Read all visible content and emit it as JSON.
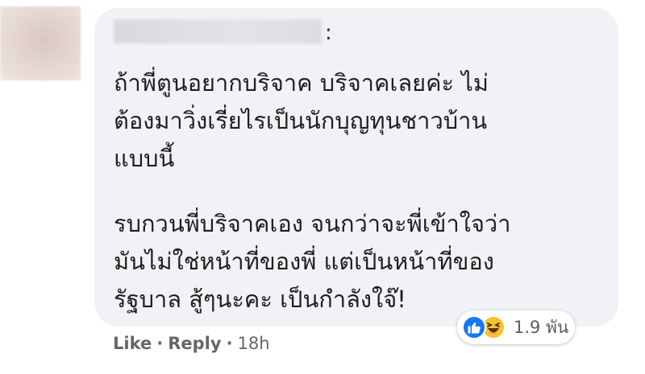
{
  "comment": {
    "author_colon": ":",
    "paragraphs": [
      "ถ้าพี่ตูนอยากบริจาค บริจาคเลยค่ะ ไม่\nต้องมาวิ่งเรี่ยไรเป็นนักบุญทุนชาวบ้าน\nแบบนี้",
      "รบกวนพี่บริจาคเอง จนกว่าจะพี่เข้าใจว่า\nมันไม่ใช่หน้าที่ของพี่ แต่เป็นหน้าที่ของ\nรัฐบาล สู้ๆนะคะ เป็นกำลังใจ๊!"
    ]
  },
  "reactions": {
    "icons": [
      "like-icon",
      "haha-icon"
    ],
    "count": "1.9 พัน",
    "colors": {
      "like": "#1877f2",
      "haha": "#f7c133"
    }
  },
  "actions": {
    "like_label": "Like",
    "separator": "·",
    "reply_label": "Reply",
    "time": "18h"
  },
  "colors": {
    "bubble": "#f0f2f5",
    "text": "#1f1f1f",
    "meta": "#63676b"
  }
}
